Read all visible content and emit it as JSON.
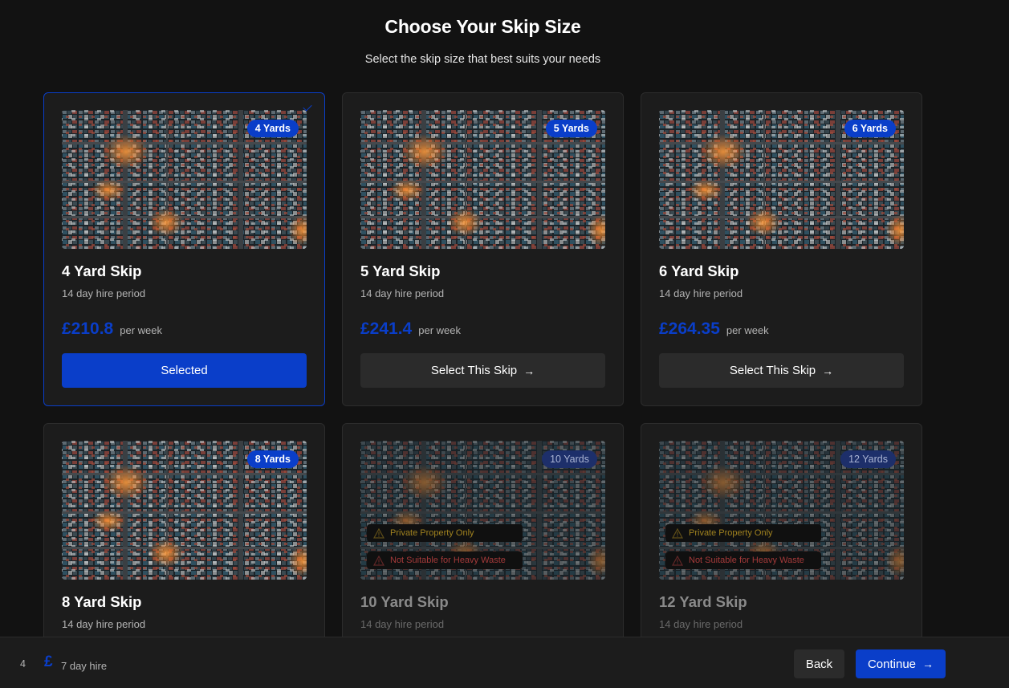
{
  "header": {
    "title": "Choose Your Skip Size",
    "subtitle": "Select the skip size that best suits your needs"
  },
  "colors": {
    "accent": "#0a3ec9",
    "background": "#121212",
    "card": "#1c1c1c",
    "button": "#2b2b2b"
  },
  "cards": [
    {
      "badge": "4 Yards",
      "title": "4 Yard Skip",
      "period": "14 day hire period",
      "price": "£210.8",
      "per": "per week",
      "button": "Selected",
      "state": "selected"
    },
    {
      "badge": "5 Yards",
      "title": "5 Yard Skip",
      "period": "14 day hire period",
      "price": "£241.4",
      "per": "per week",
      "button": "Select This Skip",
      "state": "default"
    },
    {
      "badge": "6 Yards",
      "title": "6 Yard Skip",
      "period": "14 day hire period",
      "price": "£264.35",
      "per": "per week",
      "button": "Select This Skip",
      "state": "default"
    },
    {
      "badge": "8 Yards",
      "title": "8 Yard Skip",
      "period": "14 day hire period",
      "state": "default"
    },
    {
      "badge": "10 Yards",
      "title": "10 Yard Skip",
      "period": "14 day hire period",
      "state": "disabled",
      "warning_private": "Private Property Only",
      "warning_heavy": "Not Suitable for Heavy Waste"
    },
    {
      "badge": "12 Yards",
      "title": "12 Yard Skip",
      "period": "14 day hire period",
      "state": "disabled",
      "warning_private": "Private Property Only",
      "warning_heavy": "Not Suitable for Heavy Waste"
    }
  ],
  "icons": {
    "arrow": "arrow-right-icon",
    "warning": "warning-triangle-icon",
    "check": "check-icon"
  },
  "footer": {
    "size": "4",
    "currency": "£",
    "period": "7 day hire",
    "back_label": "Back",
    "continue_label": "Continue",
    "continue_arrow": "→"
  }
}
